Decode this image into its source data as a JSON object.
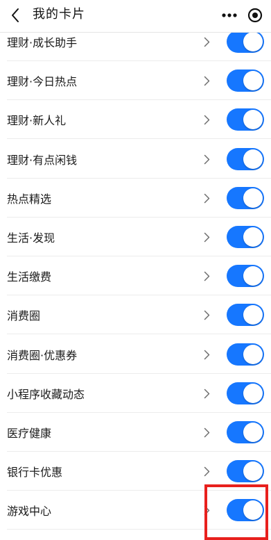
{
  "header": {
    "title": "我的卡片",
    "back_icon": "chevron-left-icon",
    "more_icon": "more-dots-icon",
    "target_icon": "target-circle-icon"
  },
  "colors": {
    "toggle_on": "#1677ff",
    "highlight": "#e8201d"
  },
  "items": [
    {
      "label": "理财·成长助手",
      "enabled": true
    },
    {
      "label": "理财·今日热点",
      "enabled": true
    },
    {
      "label": "理财·新人礼",
      "enabled": true
    },
    {
      "label": "理财·有点闲钱",
      "enabled": true
    },
    {
      "label": "热点精选",
      "enabled": true
    },
    {
      "label": "生活·发现",
      "enabled": true
    },
    {
      "label": "生活缴费",
      "enabled": true
    },
    {
      "label": "消费圈",
      "enabled": true
    },
    {
      "label": "消费圈·优惠券",
      "enabled": true
    },
    {
      "label": "小程序收藏动态",
      "enabled": true
    },
    {
      "label": "医疗健康",
      "enabled": true
    },
    {
      "label": "银行卡优惠",
      "enabled": true
    },
    {
      "label": "游戏中心",
      "enabled": true
    }
  ]
}
